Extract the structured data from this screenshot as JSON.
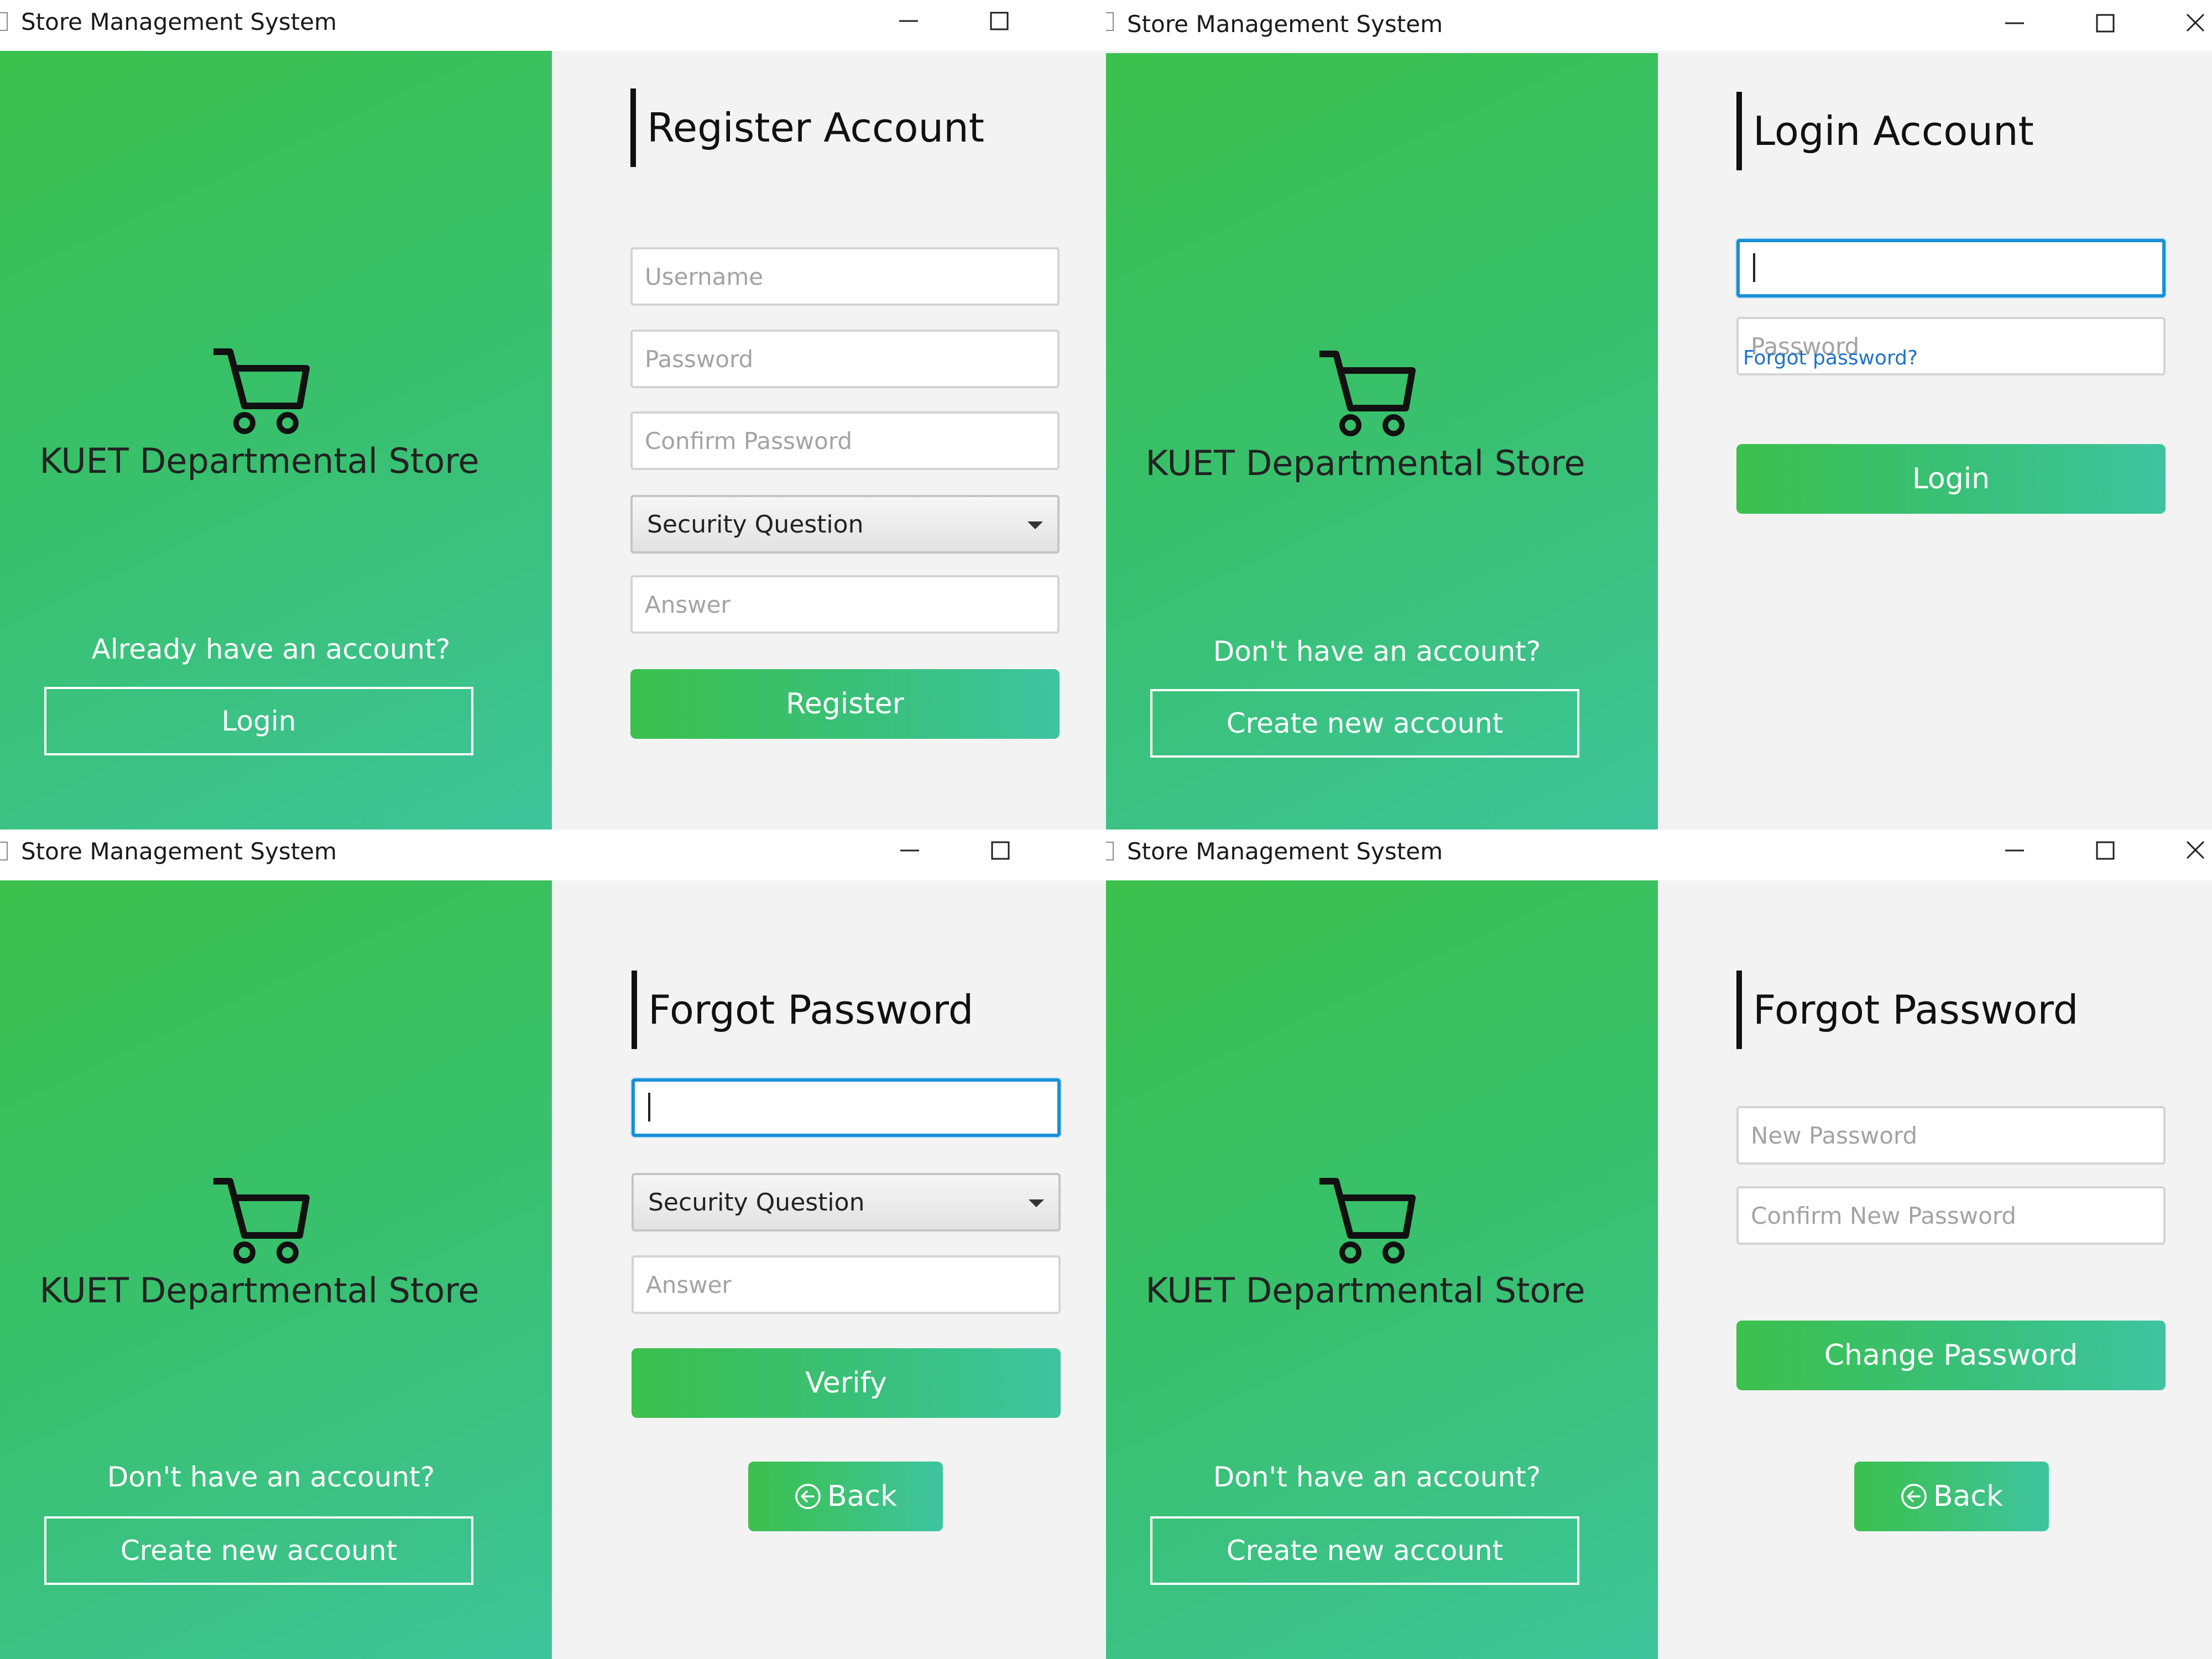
{
  "window_title": "Store Management System",
  "brand": {
    "store_name": "KUET Departmental Store",
    "colors": {
      "gradient_start": "#3cc04d",
      "gradient_end": "#3ec4a0",
      "focus": "#1a8fd6",
      "link": "#1e72c8"
    }
  },
  "icons": {
    "cart": "shopping-cart-icon",
    "back": "arrow-left-circle-icon",
    "dropdown": "caret-down-icon"
  },
  "register": {
    "title": "Register Account",
    "username_placeholder": "Username",
    "password_placeholder": "Password",
    "confirm_password_placeholder": "Confirm Password",
    "security_question": "Security Question",
    "answer_placeholder": "Answer",
    "submit_label": "Register",
    "side_prompt": "Already have an account?",
    "side_button": "Login"
  },
  "login": {
    "title": "Login Account",
    "username_value": "",
    "password_placeholder": "Password",
    "forgot_link": "Forgot password?",
    "submit_label": "Login",
    "side_prompt": "Don't have an account?",
    "side_button": "Create new account"
  },
  "forgot_verify": {
    "title": "Forgot Password",
    "username_value": "",
    "security_question": "Security Question",
    "answer_placeholder": "Answer",
    "submit_label": "Verify",
    "back_label": "Back",
    "side_prompt": "Don't have an account?",
    "side_button": "Create new account"
  },
  "forgot_reset": {
    "title": "Forgot Password",
    "new_password_placeholder": "New Password",
    "confirm_new_password_placeholder": "Confirm New Password",
    "submit_label": "Change Password",
    "back_label": "Back",
    "side_prompt": "Don't have an account?",
    "side_button": "Create new account"
  }
}
